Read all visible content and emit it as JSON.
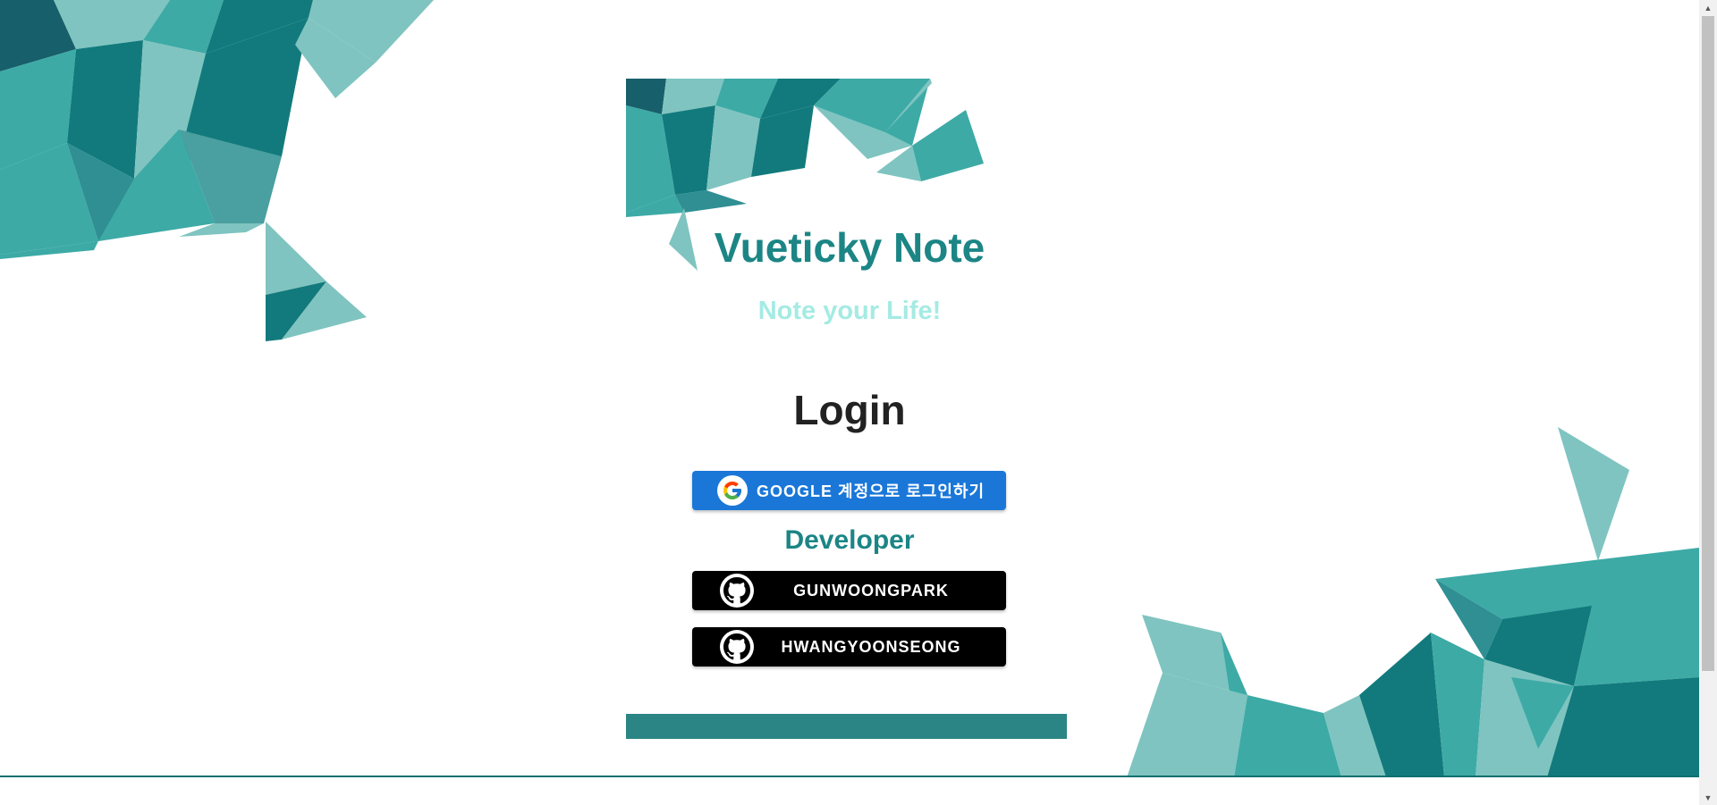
{
  "app": {
    "title": "Vueticky Note",
    "subtitle": "Note your Life!"
  },
  "login": {
    "heading": "Login",
    "google_button_label": "GOOGLE 계정으로 로그인하기"
  },
  "developer": {
    "heading": "Developer",
    "links": [
      {
        "label": "GUNWOONGPARK",
        "icon": "github-icon"
      },
      {
        "label": "HWANGYOONSEONG",
        "icon": "github-icon"
      }
    ]
  },
  "icons": {
    "google": "google-logo-icon",
    "github": "github-icon"
  },
  "colors": {
    "brand_teal": "#1c8585",
    "subtitle_mint": "#a4ebe3",
    "google_blue": "#1a77d8",
    "github_black": "#000000",
    "footer_bar": "#2b8585"
  }
}
